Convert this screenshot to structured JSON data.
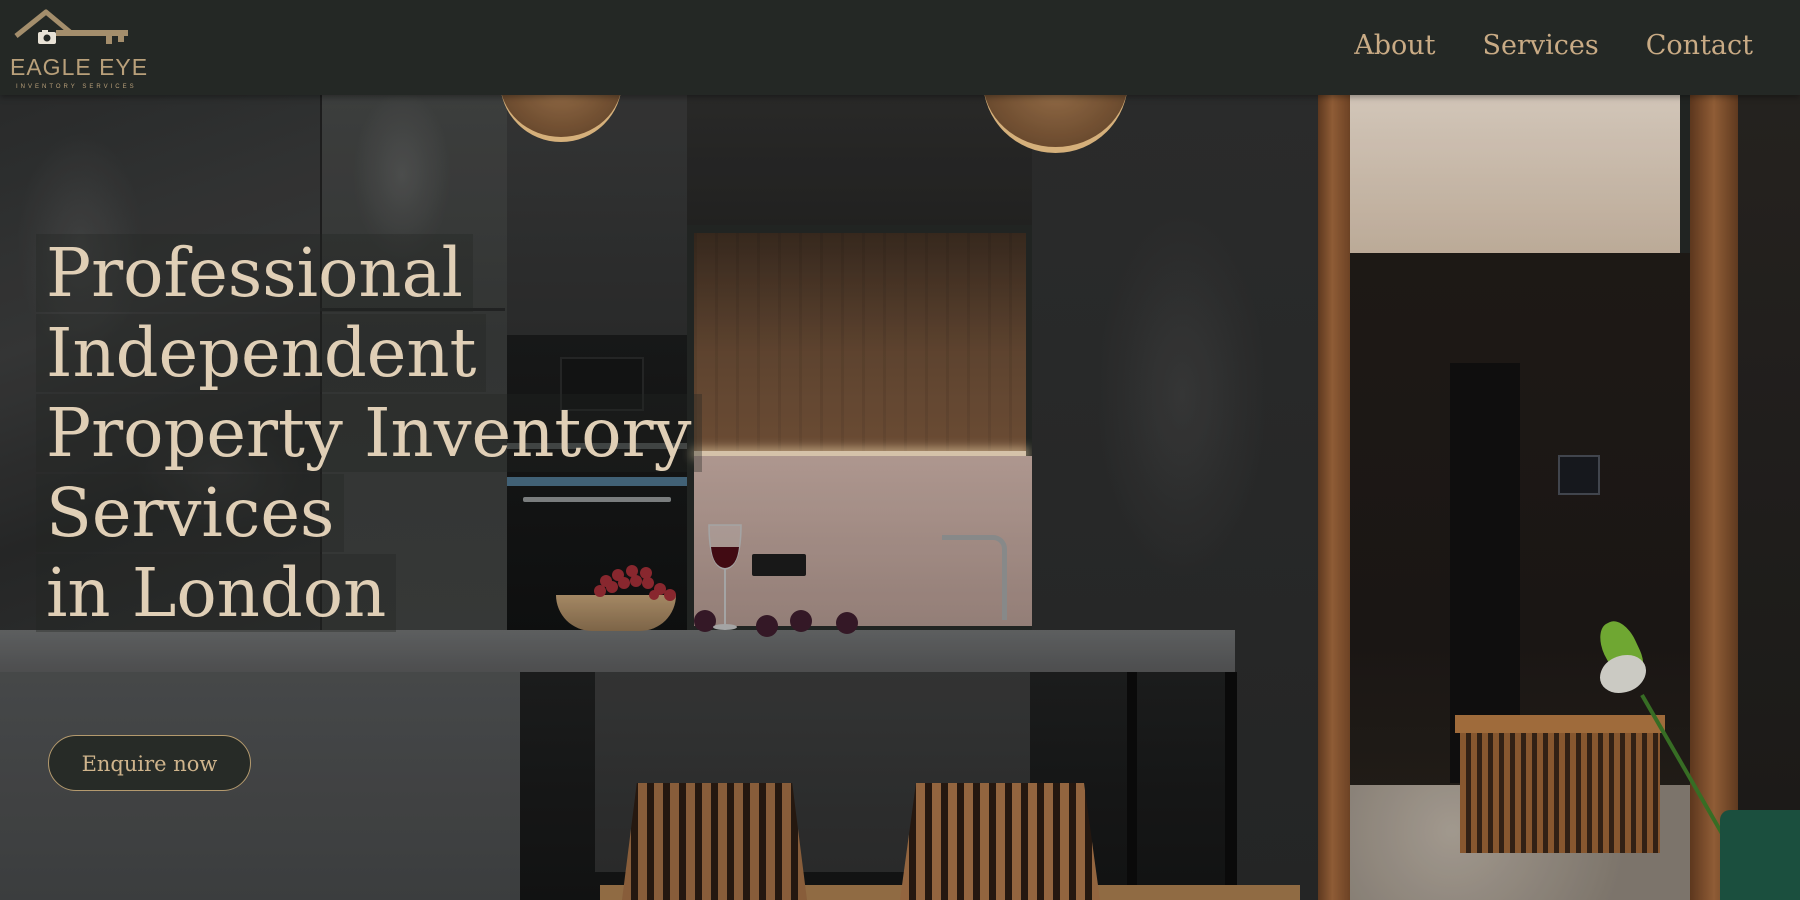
{
  "brand": {
    "name": "EAGLE EYE",
    "tagline": "INVENTORY SERVICES",
    "logo_icons": [
      "house-roof-icon",
      "camera-icon",
      "key-icon"
    ]
  },
  "nav": {
    "items": [
      {
        "label": "About"
      },
      {
        "label": "Services"
      },
      {
        "label": "Contact"
      }
    ]
  },
  "hero": {
    "title_lines": [
      "Professional Independent",
      "Property Inventory",
      "Services",
      "in London"
    ],
    "cta_label": "Enquire now",
    "background_image": "dark modern kitchen with wooden accents and hallway"
  },
  "colors": {
    "header_bg": "#242825",
    "accent_gold": "#c9ab85",
    "title_cream": "#e0cfb6",
    "button_bg": "#272b27"
  }
}
